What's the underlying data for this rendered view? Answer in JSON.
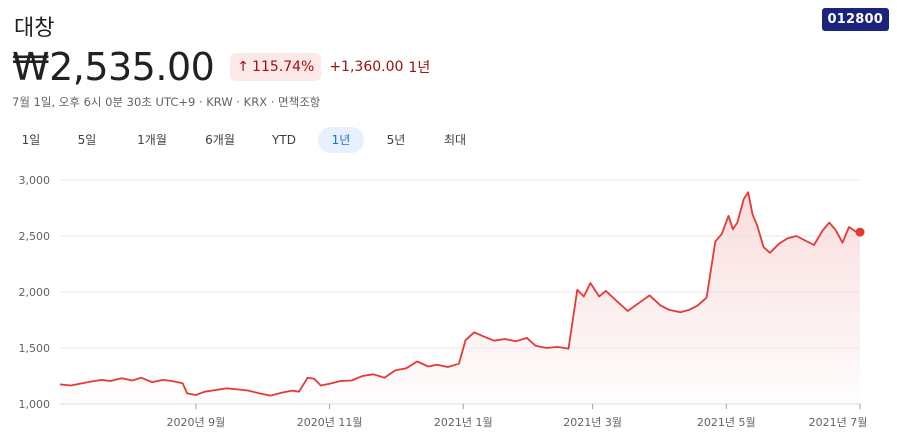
{
  "header": {
    "name": "대창",
    "ticker": "012800"
  },
  "quote": {
    "price": "₩2,535.00",
    "change_pct": "115.74%",
    "change_abs": "+1,360.00",
    "change_period": "1년",
    "meta": "7월 1일, 오후 6시 0분 30초 UTC+9 · KRW · KRX · 면책조항"
  },
  "ranges": [
    {
      "label": "1일",
      "active": false
    },
    {
      "label": "5일",
      "active": false
    },
    {
      "label": "1개월",
      "active": false
    },
    {
      "label": "6개월",
      "active": false
    },
    {
      "label": "YTD",
      "active": false
    },
    {
      "label": "1년",
      "active": true
    },
    {
      "label": "5년",
      "active": false
    },
    {
      "label": "최대",
      "active": false
    }
  ],
  "colors": {
    "line": "#e53935",
    "fill": "#f8d7d7",
    "grid": "#e8eaed",
    "active_tab_bg": "#e8f0fe"
  },
  "chart_data": {
    "type": "area",
    "title": "",
    "xlabel": "",
    "ylabel": "",
    "ylim": [
      1000,
      3000
    ],
    "y_ticks": [
      1000,
      1500,
      2000,
      2500,
      3000
    ],
    "y_tick_labels": [
      "1,000",
      "1,500",
      "2,000",
      "2,500",
      "3,000"
    ],
    "x_ticks": [
      {
        "date": "2020-09-01",
        "label": "2020년 9월"
      },
      {
        "date": "2020-11-01",
        "label": "2020년 11월"
      },
      {
        "date": "2021-01-01",
        "label": "2021년 1월"
      },
      {
        "date": "2021-03-01",
        "label": "2021년 3월"
      },
      {
        "date": "2021-05-01",
        "label": "2021년 5월"
      },
      {
        "date": "2021-07-01",
        "label": "2021년 7월"
      }
    ],
    "x_range": [
      "2020-07-01",
      "2021-07-01"
    ],
    "grid": true,
    "legend": "none",
    "series": [
      {
        "points": [
          [
            "2020-07-01",
            1175
          ],
          [
            "2020-07-06",
            1165
          ],
          [
            "2020-07-10",
            1180
          ],
          [
            "2020-07-15",
            1200
          ],
          [
            "2020-07-20",
            1215
          ],
          [
            "2020-07-24",
            1205
          ],
          [
            "2020-07-29",
            1230
          ],
          [
            "2020-08-03",
            1210
          ],
          [
            "2020-08-07",
            1235
          ],
          [
            "2020-08-12",
            1195
          ],
          [
            "2020-08-17",
            1215
          ],
          [
            "2020-08-21",
            1205
          ],
          [
            "2020-08-26",
            1185
          ],
          [
            "2020-08-28",
            1095
          ],
          [
            "2020-09-01",
            1080
          ],
          [
            "2020-09-05",
            1110
          ],
          [
            "2020-09-10",
            1125
          ],
          [
            "2020-09-15",
            1140
          ],
          [
            "2020-09-20",
            1130
          ],
          [
            "2020-09-25",
            1120
          ],
          [
            "2020-09-30",
            1095
          ],
          [
            "2020-10-05",
            1075
          ],
          [
            "2020-10-10",
            1100
          ],
          [
            "2020-10-15",
            1120
          ],
          [
            "2020-10-18",
            1110
          ],
          [
            "2020-10-22",
            1235
          ],
          [
            "2020-10-25",
            1225
          ],
          [
            "2020-10-28",
            1165
          ],
          [
            "2020-11-01",
            1180
          ],
          [
            "2020-11-06",
            1205
          ],
          [
            "2020-11-11",
            1210
          ],
          [
            "2020-11-16",
            1250
          ],
          [
            "2020-11-21",
            1265
          ],
          [
            "2020-11-26",
            1235
          ],
          [
            "2020-12-01",
            1300
          ],
          [
            "2020-12-06",
            1320
          ],
          [
            "2020-12-11",
            1380
          ],
          [
            "2020-12-16",
            1335
          ],
          [
            "2020-12-20",
            1350
          ],
          [
            "2020-12-25",
            1330
          ],
          [
            "2020-12-30",
            1360
          ],
          [
            "2021-01-02",
            1570
          ],
          [
            "2021-01-06",
            1640
          ],
          [
            "2021-01-10",
            1605
          ],
          [
            "2021-01-15",
            1565
          ],
          [
            "2021-01-20",
            1580
          ],
          [
            "2021-01-25",
            1560
          ],
          [
            "2021-01-30",
            1590
          ],
          [
            "2021-02-03",
            1520
          ],
          [
            "2021-02-08",
            1500
          ],
          [
            "2021-02-13",
            1510
          ],
          [
            "2021-02-18",
            1495
          ],
          [
            "2021-02-22",
            2020
          ],
          [
            "2021-02-25",
            1960
          ],
          [
            "2021-02-28",
            2080
          ],
          [
            "2021-03-04",
            1960
          ],
          [
            "2021-03-07",
            2010
          ],
          [
            "2021-03-12",
            1920
          ],
          [
            "2021-03-17",
            1830
          ],
          [
            "2021-03-22",
            1900
          ],
          [
            "2021-03-27",
            1970
          ],
          [
            "2021-04-01",
            1880
          ],
          [
            "2021-04-05",
            1840
          ],
          [
            "2021-04-10",
            1820
          ],
          [
            "2021-04-14",
            1840
          ],
          [
            "2021-04-18",
            1880
          ],
          [
            "2021-04-22",
            1950
          ],
          [
            "2021-04-26",
            2450
          ],
          [
            "2021-04-29",
            2520
          ],
          [
            "2021-05-02",
            2680
          ],
          [
            "2021-05-04",
            2560
          ],
          [
            "2021-05-06",
            2620
          ],
          [
            "2021-05-09",
            2830
          ],
          [
            "2021-05-11",
            2890
          ],
          [
            "2021-05-13",
            2690
          ],
          [
            "2021-05-15",
            2600
          ],
          [
            "2021-05-18",
            2400
          ],
          [
            "2021-05-21",
            2350
          ],
          [
            "2021-05-25",
            2430
          ],
          [
            "2021-05-29",
            2480
          ],
          [
            "2021-06-02",
            2500
          ],
          [
            "2021-06-06",
            2460
          ],
          [
            "2021-06-10",
            2420
          ],
          [
            "2021-06-14",
            2550
          ],
          [
            "2021-06-17",
            2620
          ],
          [
            "2021-06-20",
            2550
          ],
          [
            "2021-06-23",
            2440
          ],
          [
            "2021-06-26",
            2580
          ],
          [
            "2021-06-29",
            2540
          ],
          [
            "2021-07-01",
            2535
          ]
        ]
      }
    ]
  }
}
